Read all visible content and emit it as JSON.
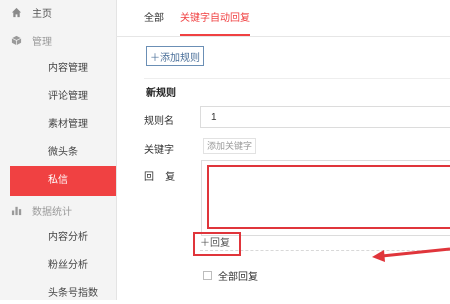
{
  "sidebar": {
    "home": {
      "label": "主页",
      "icon": "home-icon"
    },
    "manage": {
      "label": "管理",
      "icon": "cube-icon"
    },
    "manage_items": [
      "内容管理",
      "评论管理",
      "素材管理",
      "微头条"
    ],
    "active_item": "私信",
    "stats": {
      "label": "数据统计",
      "icon": "bar-chart-icon"
    },
    "stats_items": [
      "内容分析",
      "粉丝分析",
      "头条号指数"
    ]
  },
  "tabs": [
    "全部",
    "关键字自动回复"
  ],
  "active_tab": "关键字自动回复",
  "add_rule_button": "＋添加规则",
  "form": {
    "section_title": "新规则",
    "rule_name_label": "规则名",
    "rule_name_value": "1",
    "keyword_label": "关键字",
    "keyword_add": "添加关键字",
    "reply_label": "回    复",
    "reply_add": "＋回复",
    "reply_all_label": "全部回复"
  },
  "colors": {
    "accent": "#f04142",
    "highlight": "#e0353b",
    "button_border": "#6b8fb5"
  }
}
